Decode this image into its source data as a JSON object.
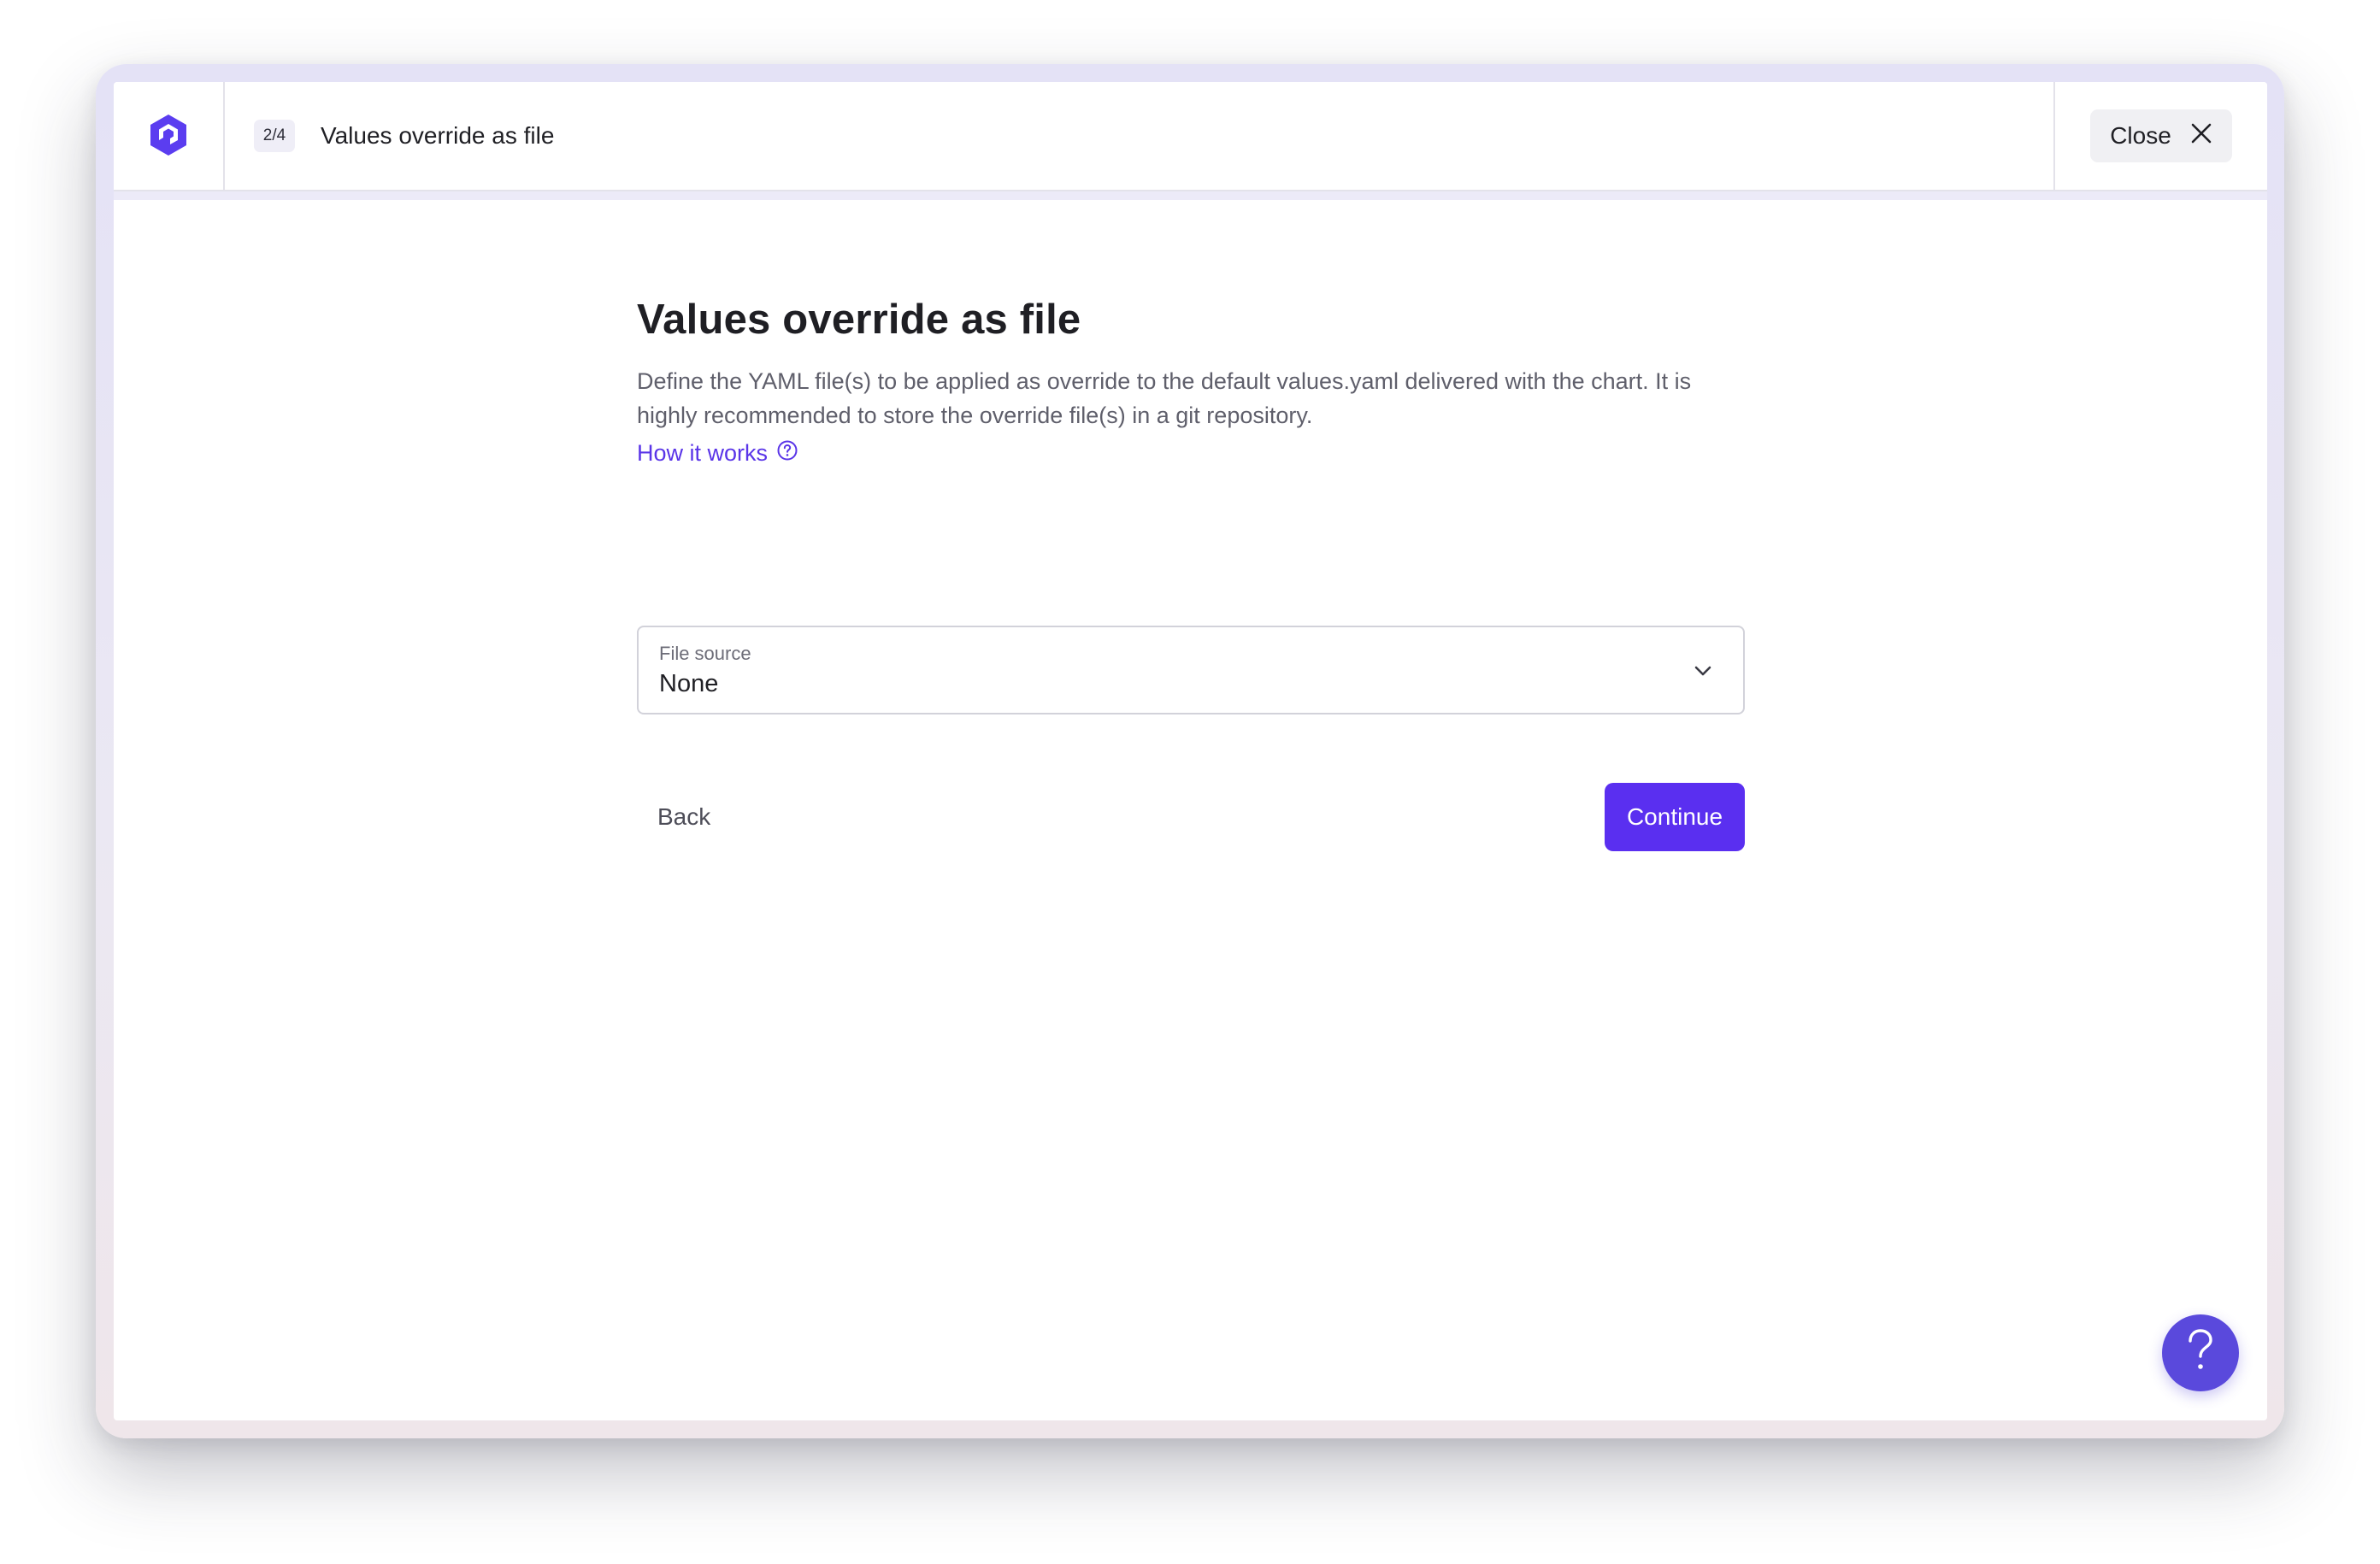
{
  "header": {
    "step_badge": "2/4",
    "title": "Values override as file",
    "close_label": "Close"
  },
  "main": {
    "heading": "Values override as file",
    "description": "Define the YAML file(s) to be applied as override to the default values.yaml delivered with the chart. It is highly recommended to store the override file(s) in a git repository.",
    "how_it_works_label": "How it works",
    "file_source": {
      "label": "File source",
      "value": "None"
    },
    "back_label": "Back",
    "continue_label": "Continue"
  },
  "icons": {
    "logo": "logo-icon",
    "close": "close-icon",
    "help_circle": "help-circle-icon",
    "chevron": "chevron-down-icon",
    "help_fab": "question-mark-icon"
  },
  "colors": {
    "accent": "#5a2ff0",
    "link": "#5a35e8",
    "fab": "#5a49dc"
  }
}
